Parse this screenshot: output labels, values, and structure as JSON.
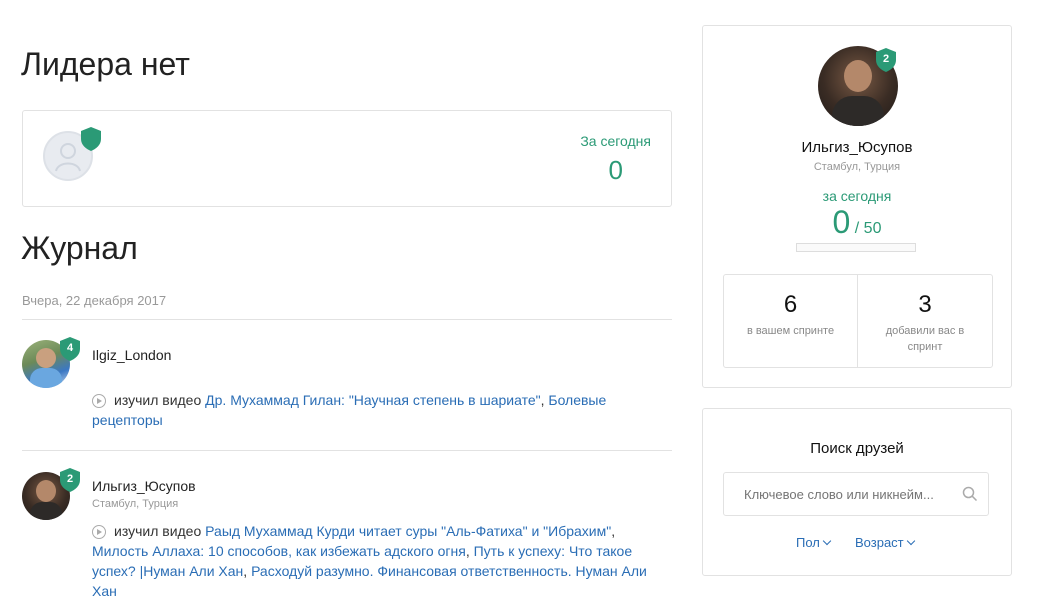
{
  "leader": {
    "title": "Лидера нет",
    "today_label": "За сегодня",
    "today_value": "0"
  },
  "journal": {
    "title": "Журнал",
    "date": "Вчера, 22 декабря 2017",
    "entries": [
      {
        "name": "Ilgiz_London",
        "location": "",
        "badge": "4",
        "action": "изучил видео",
        "links": [
          "Др. Мухаммад Гилан: \"Научная степень в шариате\"",
          "Болевые рецепторы"
        ]
      },
      {
        "name": "Ильгиз_Юсупов",
        "location": "Стамбул, Турция",
        "badge": "2",
        "action": "изучил видео",
        "links": [
          "Раыд Мухаммад Курди читает суры \"Аль-Фатиха\" и \"Ибрахим\"",
          "Милость Аллаха: 10 способов, как избежать адского огня",
          "Путь к успеху: Что такое успех? |Нуман Али Хан",
          "Расходуй разумно. Финансовая ответственность. Нуман Али Хан"
        ]
      }
    ]
  },
  "profile": {
    "badge": "2",
    "name": "Ильгиз_Юсупов",
    "location": "Стамбул, Турция",
    "today_label": "за сегодня",
    "today_value": "0",
    "today_goal": "/ 50",
    "progress_fraction": 0,
    "stats": [
      {
        "value": "6",
        "label": "в вашем спринте"
      },
      {
        "value": "3",
        "label": "добавили вас в спринт"
      }
    ]
  },
  "friends": {
    "title": "Поиск друзей",
    "search_placeholder": "Ключевое слово или никнейм...",
    "filter_gender": "Пол",
    "filter_age": "Возраст"
  },
  "colors": {
    "accent_green": "#2b9a76",
    "link_blue": "#2a6db5"
  }
}
